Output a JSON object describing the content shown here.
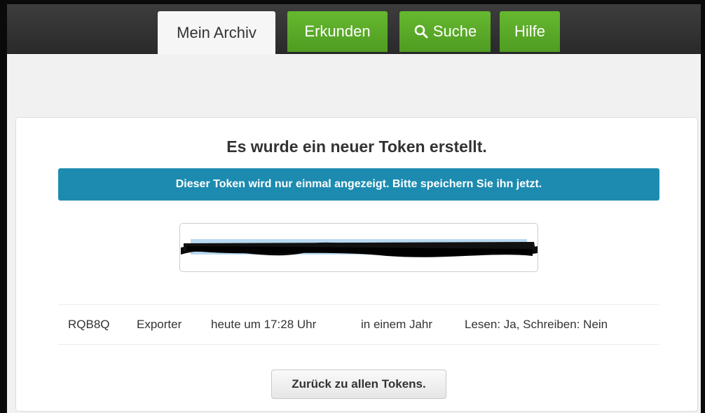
{
  "nav": {
    "tabs": [
      {
        "label": "Mein Archiv",
        "active": true
      },
      {
        "label": "Erkunden",
        "active": false
      },
      {
        "label": "Suche",
        "active": false,
        "icon": "search-icon"
      },
      {
        "label": "Hilfe",
        "active": false
      }
    ]
  },
  "panel": {
    "title": "Es wurde ein neuer Token erstellt.",
    "info": "Dieser Token wird nur einmal angezeigt. Bitte speichern Sie ihn jetzt.",
    "token_state": "redacted"
  },
  "token": {
    "id": "RQB8Q",
    "name": "Exporter",
    "created": "heute um 17:28 Uhr",
    "expires": "in einem Jahr",
    "permissions": "Lesen: Ja, Schreiben: Nein"
  },
  "actions": {
    "back_label": "Zurück zu allen Tokens."
  },
  "colors": {
    "tab_green": "#5cab2a",
    "info_blue": "#1d8bb0",
    "top_bar": "#333333"
  }
}
